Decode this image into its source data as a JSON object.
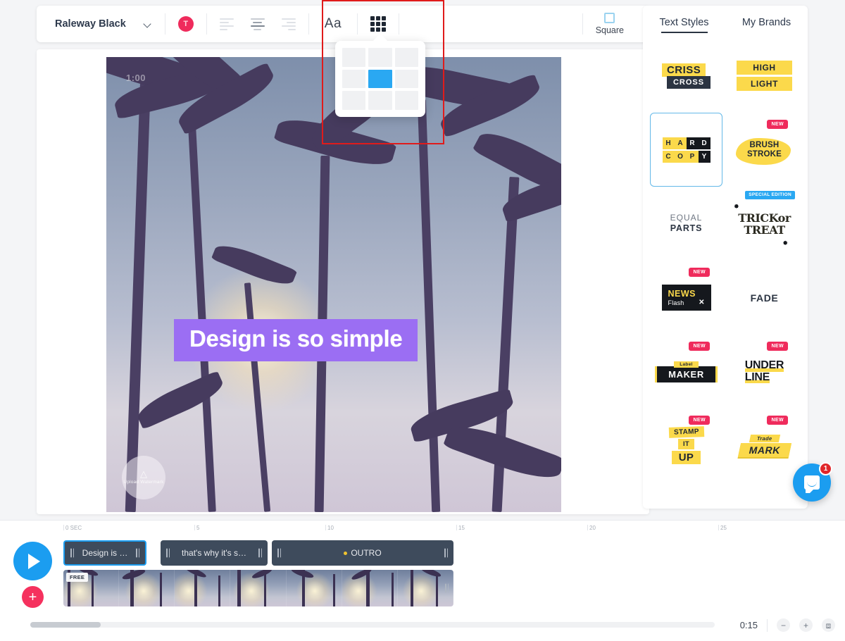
{
  "toolbar": {
    "font_name": "Raleway Black",
    "chevron_icon": "chevron-down-icon",
    "color_swatch_letter": "T",
    "align_left_icon": "align-left-icon",
    "align_center_icon": "align-center-icon",
    "align_right_icon": "align-right-icon",
    "text_size_label": "Aa",
    "grid_icon": "grid-icon",
    "square_label": "Square",
    "square_icon": "square-outline-icon"
  },
  "grid_popup": {
    "rows": 3,
    "cols": 3,
    "selected_cell": 4
  },
  "canvas": {
    "time_overlay": "1:00",
    "text_element": "Design is so simple",
    "text_highlight_color": "#9b6ef3",
    "text_color": "#ffffff",
    "watermark_icon": "upload-icon",
    "watermark_label": "Upload Watermark"
  },
  "sidebar": {
    "tabs": [
      {
        "label": "Text Styles",
        "active": true
      },
      {
        "label": "My Brands",
        "active": false
      }
    ],
    "styles": [
      {
        "name": "criss-cross",
        "line1": "CRISS",
        "line2": "CROSS",
        "badge": "",
        "selected": false
      },
      {
        "name": "high-light",
        "line1": "HIGH",
        "line2": "LIGHT",
        "badge": "",
        "selected": false
      },
      {
        "name": "hard-copy",
        "line1": "HARD",
        "line2": "COPY",
        "badge": "",
        "selected": true
      },
      {
        "name": "brush-stroke",
        "line1": "BRUSH",
        "line2": "STROKE",
        "badge": "NEW",
        "selected": false
      },
      {
        "name": "equal-parts",
        "line1": "EQUAL",
        "line2": "PARTS",
        "badge": "",
        "selected": false
      },
      {
        "name": "trick-or-treat",
        "line1": "TRICKor",
        "line2": "TREAT",
        "badge": "SPECIAL EDITION",
        "selected": false
      },
      {
        "name": "news-flash",
        "line1": "NEWS",
        "line2": "Flash",
        "badge": "NEW",
        "selected": false
      },
      {
        "name": "fade",
        "line1": "FADE",
        "line2": "",
        "badge": "",
        "selected": false
      },
      {
        "name": "label-maker",
        "line1": "Label",
        "line2": "MAKER",
        "badge": "NEW",
        "selected": false
      },
      {
        "name": "under-line",
        "line1": "UNDER",
        "line2": "LINE",
        "badge": "NEW",
        "selected": false
      },
      {
        "name": "stamp-it-up",
        "line1": "STAMP",
        "line2": "IT",
        "line3": "UP",
        "badge": "NEW",
        "selected": false
      },
      {
        "name": "trade-mark",
        "line1": "Trade",
        "line2": "MARK",
        "badge": "NEW",
        "selected": false
      }
    ],
    "badge_colors": {
      "new": "#ef2b5c",
      "special": "#2aa8f2"
    }
  },
  "chat": {
    "icon": "chat-bubble-icon",
    "unread_count": "1",
    "accent": "#1b9df0",
    "badge_color": "#e0262a"
  },
  "timeline": {
    "play_icon": "play-icon",
    "add_label": "+",
    "ruler_ticks": [
      "0 SEC",
      "5",
      "10",
      "15",
      "20",
      "25"
    ],
    "text_clips": [
      {
        "label": "Design is …",
        "selected": true,
        "dot": false
      },
      {
        "label": "that's why it's s…",
        "selected": false,
        "dot": false
      },
      {
        "label": "OUTRO",
        "selected": false,
        "dot": true
      }
    ],
    "video_track_badge": "FREE",
    "duration": "0:15",
    "zoom_out_icon": "minus-icon",
    "zoom_in_icon": "plus-icon",
    "fit_icon": "fit-screen-icon"
  },
  "annotation": {
    "name": "highlight-rectangle",
    "color": "#e01b1b"
  }
}
